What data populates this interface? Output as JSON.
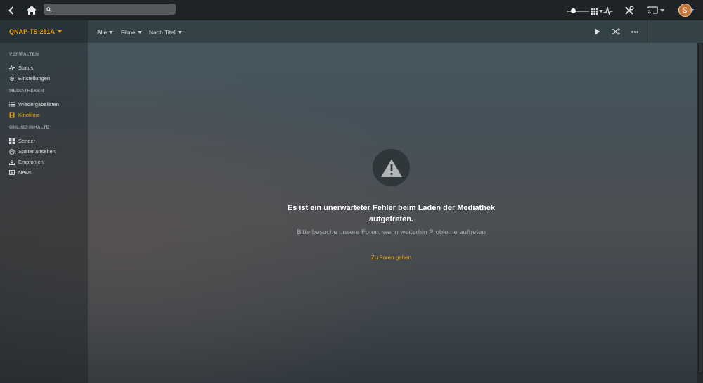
{
  "topbar": {
    "search_placeholder": ""
  },
  "user": {
    "initial": "S"
  },
  "sidebar": {
    "server_name": "QNAP-TS-251A",
    "sections": [
      {
        "title": "VERWALTEN",
        "items": [
          {
            "label": "Status",
            "icon": "activity-icon"
          },
          {
            "label": "Einstellungen",
            "icon": "gear-icon"
          }
        ]
      },
      {
        "title": "MEDIATHEKEN",
        "items": [
          {
            "label": "Wiedergabelisten",
            "icon": "list-icon"
          },
          {
            "label": "Kinofilme",
            "icon": "film-icon",
            "active": true
          }
        ]
      },
      {
        "title": "ONLINE-INHALTE",
        "items": [
          {
            "label": "Sender",
            "icon": "grid-icon"
          },
          {
            "label": "Später ansehen",
            "icon": "clock-icon"
          },
          {
            "label": "Empfohlen",
            "icon": "download-icon"
          },
          {
            "label": "News",
            "icon": "news-icon"
          }
        ]
      }
    ]
  },
  "toolbar": {
    "filter_all": "Alle",
    "filter_type": "Filme",
    "filter_sort": "Nach Titel"
  },
  "error": {
    "title": "Es ist ein unerwarteter Fehler beim Laden der Mediathek aufgetreten.",
    "subtitle": "Bitte besuche unsere Foren, wenn weiterhin Probleme auftreten",
    "link": "Zu Foren gehen"
  },
  "colors": {
    "accent": "#e5a00d",
    "topbar": "#1e2326"
  }
}
